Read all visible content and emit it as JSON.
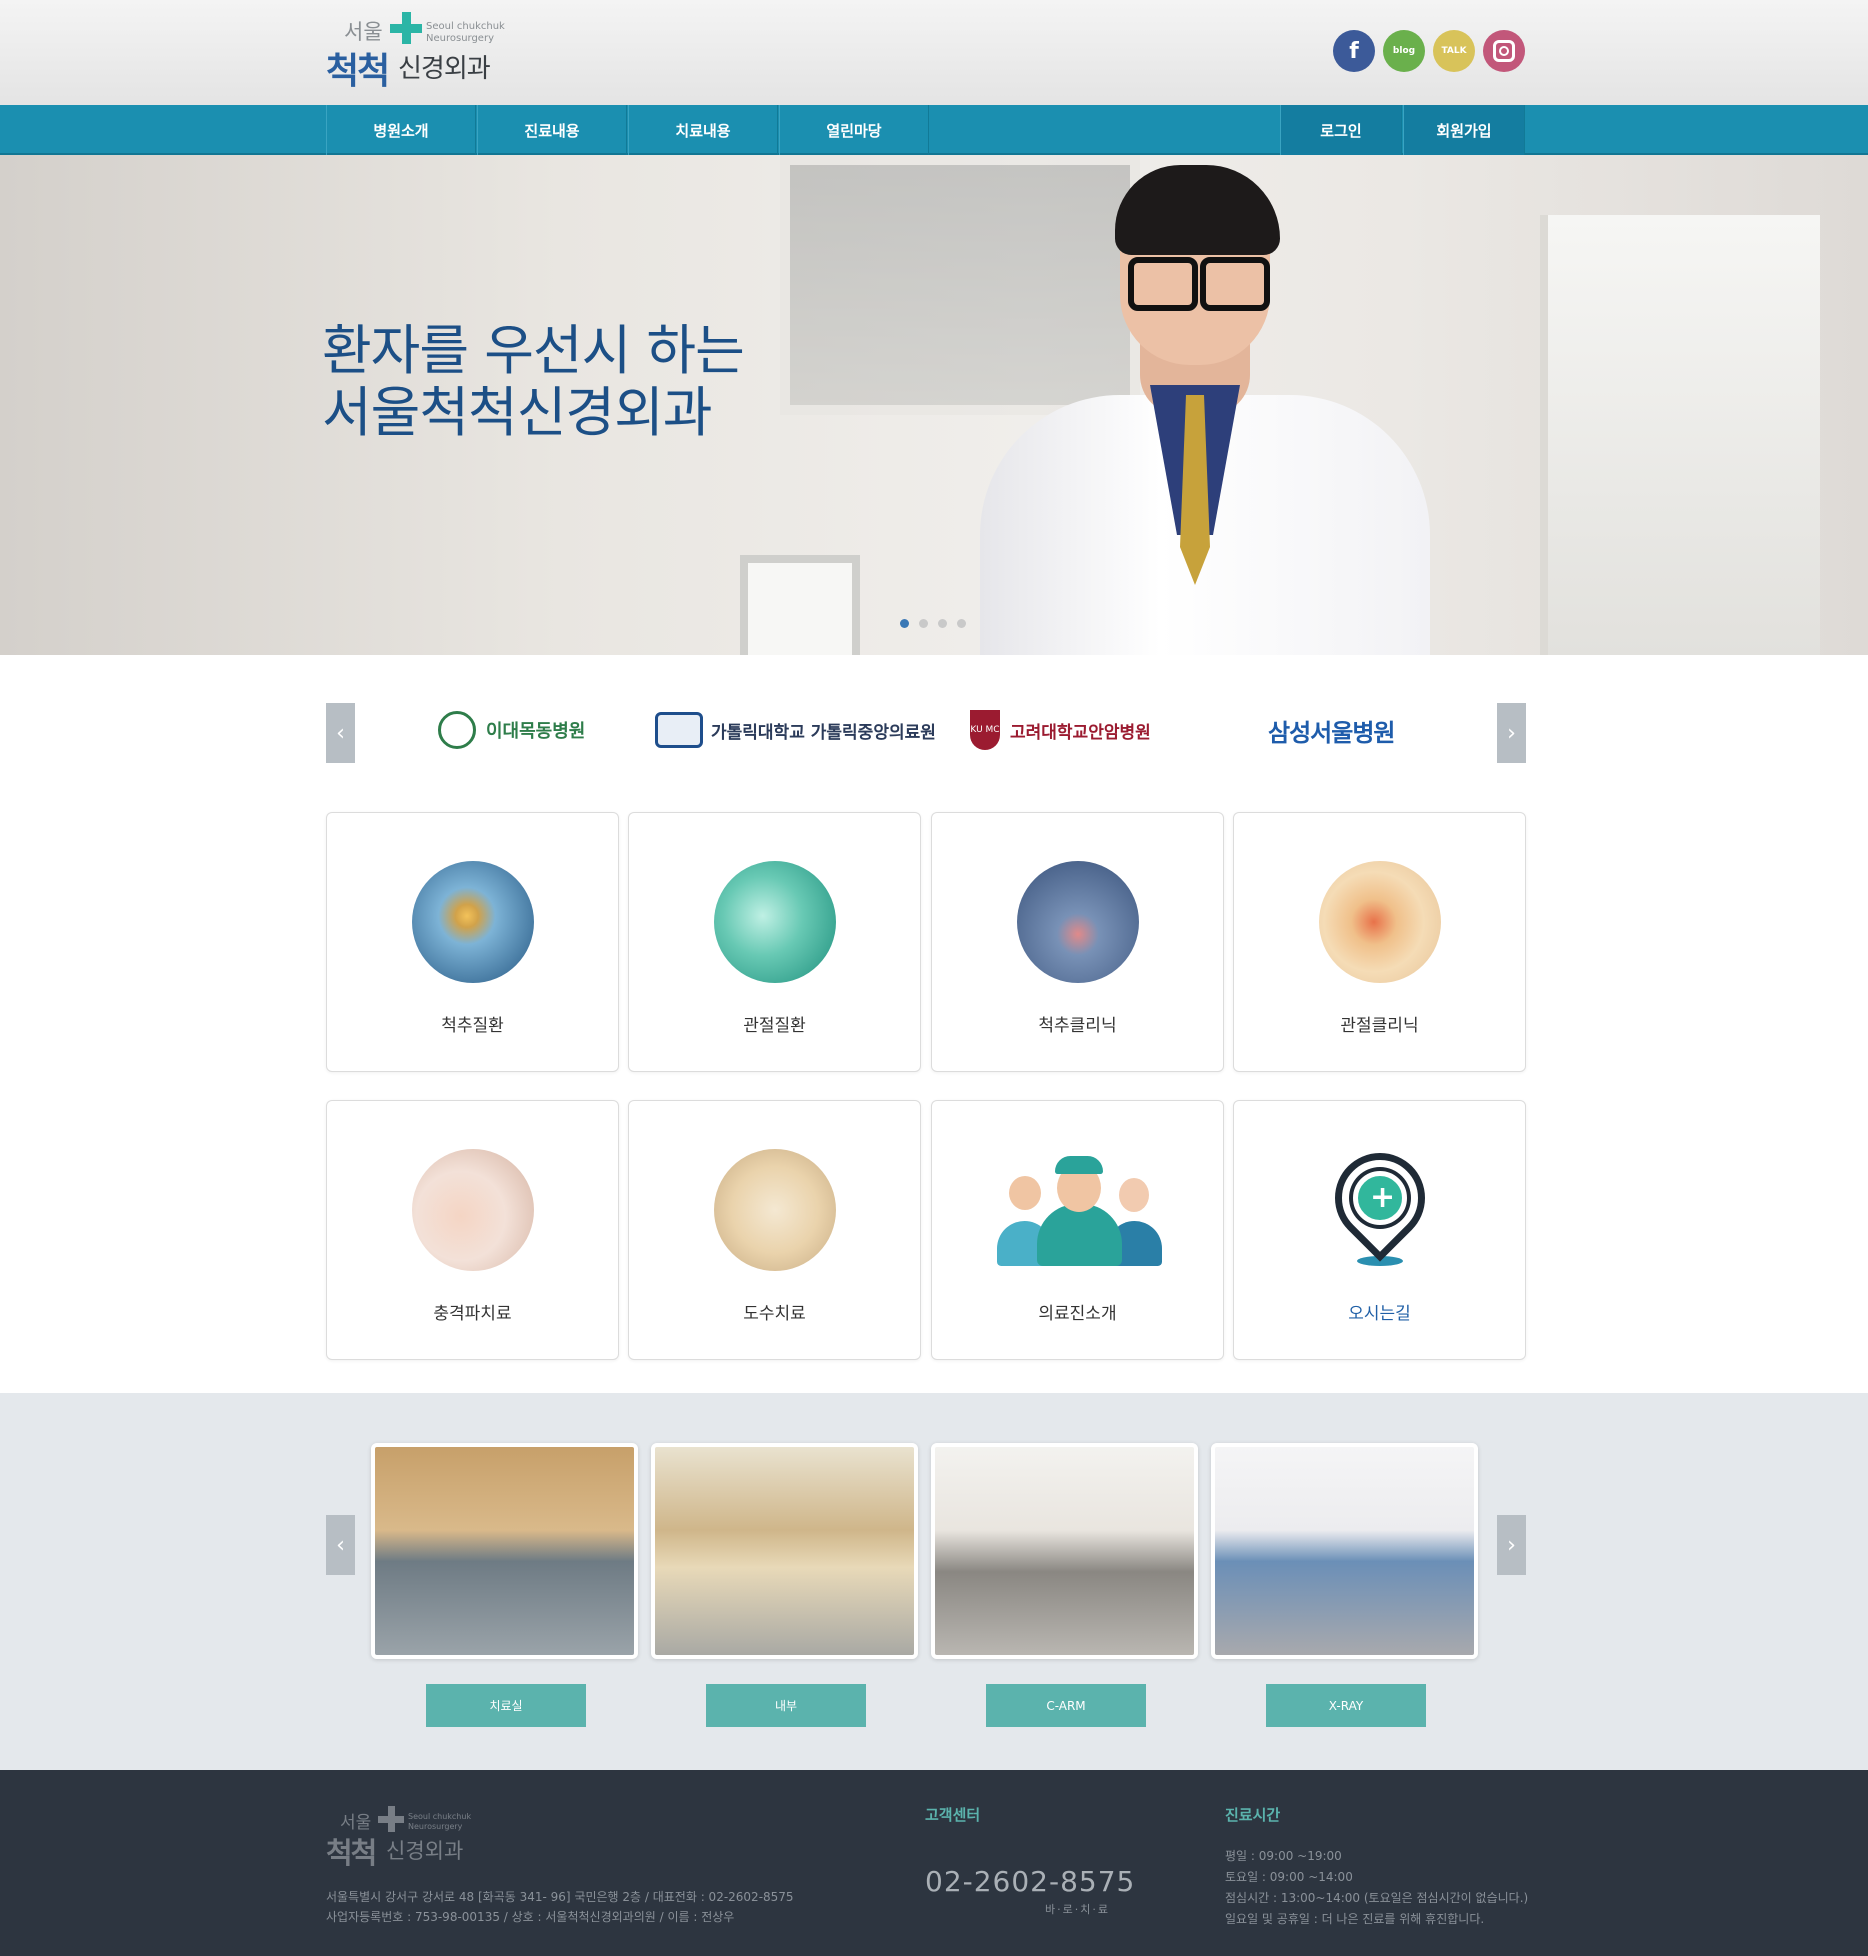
{
  "header": {
    "logo": {
      "seoul": "서울",
      "en_line1": "Seoul chukchuk",
      "en_line2": "Neurosurgery",
      "main": "척척",
      "sub": "신경외과"
    },
    "sns": {
      "facebook": "f",
      "blog": "blog",
      "talk": "TALK"
    }
  },
  "nav": {
    "items": [
      "병원소개",
      "진료내용",
      "치료내용",
      "열린마당"
    ],
    "login": "로그인",
    "signup": "회원가입"
  },
  "hero": {
    "title_line1": "환자를 우선시 하는",
    "title_line2": "서울척척신경외과",
    "slide_count": 4,
    "active_slide": 1
  },
  "partners": [
    {
      "name": "이대목동병원",
      "color": "#2e7d4a"
    },
    {
      "name": "가톨릭대학교 가톨릭중앙의료원",
      "color": "#2b3b5a"
    },
    {
      "name": "고려대학교안암병원",
      "color": "#9b1b30",
      "mark": "KU MC"
    },
    {
      "name": "삼성서울병원",
      "color": "#1e5cab"
    }
  ],
  "arrows": {
    "prev": "‹",
    "next": "›"
  },
  "services": [
    {
      "label": "척추질환",
      "icon": "spine-image"
    },
    {
      "label": "관절질환",
      "icon": "joint-image"
    },
    {
      "label": "척추클리닉",
      "icon": "spine-clinic-image"
    },
    {
      "label": "관절클리닉",
      "icon": "knee-clinic-image"
    },
    {
      "label": "충격파치료",
      "icon": "shockwave-image"
    },
    {
      "label": "도수치료",
      "icon": "manual-therapy-image"
    },
    {
      "label": "의료진소개",
      "icon": "medical-staff-icon"
    },
    {
      "label": "오시는길",
      "icon": "location-pin-icon"
    }
  ],
  "gallery": [
    {
      "label": "치료실"
    },
    {
      "label": "내부"
    },
    {
      "label": "C-ARM"
    },
    {
      "label": "X-RAY"
    }
  ],
  "footer": {
    "logo": {
      "seoul": "서울",
      "en_line1": "Seoul chukchuk",
      "en_line2": "Neurosurgery",
      "main": "척척",
      "sub": "신경외과"
    },
    "address_line1": "서울특별시 강서구 강서로 48 [화곡동 341- 96] 국민은행 2층 / 대표전화 : 02-2602-8575",
    "address_line2": "사업자등록번호 : 753-98-00135 / 상호 : 서울척척신경외과의원 / 이름 : 전상우",
    "customer_center_title": "고객센터",
    "tel": "02-2602-8575",
    "tel_sub": "바·로·치·료",
    "hours_title": "진료시간",
    "hours": [
      "평일 : 09:00 ~19:00",
      "토요일 : 09:00 ~14:00",
      "점심시간 : 13:00~14:00 (토요일은 점심시간이 없습니다.)",
      "일요일 및 공휴일 : 더 나은 진료를 위해 휴진합니다."
    ]
  },
  "colors": {
    "nav": "#1b8fb0",
    "accent": "#2bb5a6",
    "title": "#1c4f86",
    "gallery_button": "#5bb3ad",
    "footer": "#2d3540"
  }
}
